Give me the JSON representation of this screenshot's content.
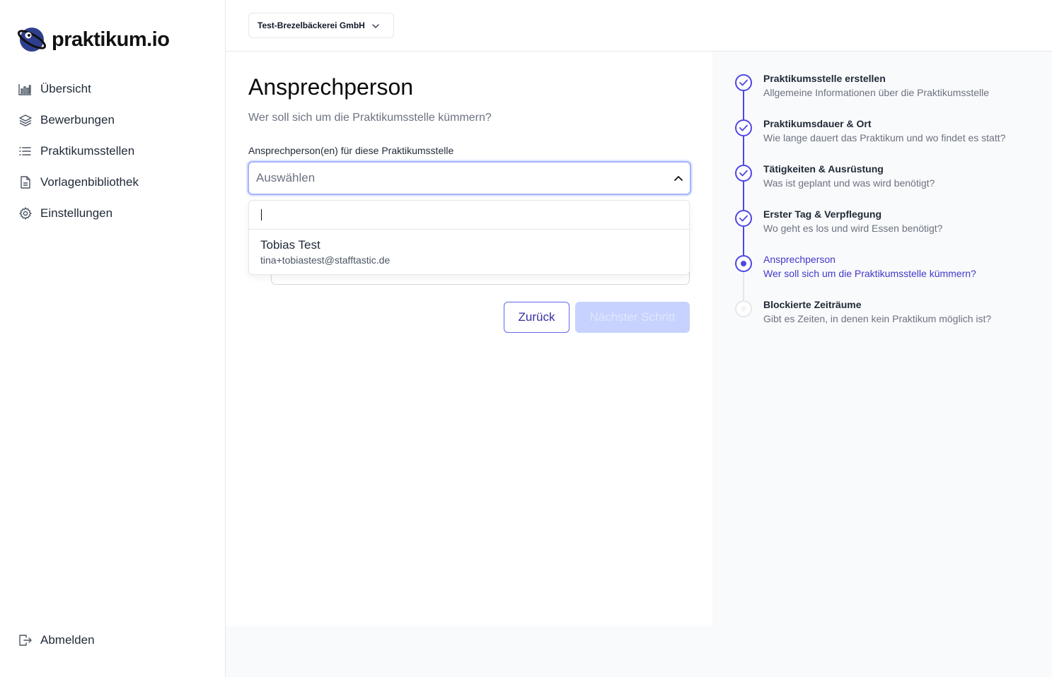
{
  "brand": {
    "name": "praktikum.io"
  },
  "sidebar": {
    "items": [
      {
        "label": "Übersicht",
        "icon": "bar-chart-icon"
      },
      {
        "label": "Bewerbungen",
        "icon": "layers-icon"
      },
      {
        "label": "Praktikumsstellen",
        "icon": "list-icon"
      },
      {
        "label": "Vorlagenbibliothek",
        "icon": "document-icon"
      },
      {
        "label": "Einstellungen",
        "icon": "gear-icon"
      }
    ],
    "logout_label": "Abmelden"
  },
  "topbar": {
    "company": "Test-Brezelbäckerei GmbH"
  },
  "main": {
    "title": "Ansprechperson",
    "subtitle": "Wer soll sich um die Praktikumsstelle kümmern?",
    "field_label": "Ansprechperson(en) für diese Praktikumsstelle",
    "select_placeholder": "Auswählen",
    "options": [
      {
        "name": "Tobias Test",
        "email": "tina+tobiastest@stafftastic.de"
      }
    ],
    "back_label": "Zurück",
    "next_label": "Nächster Schritt"
  },
  "steps": [
    {
      "title": "Praktikumsstelle erstellen",
      "desc": "Allgemeine Informationen über die Praktikumsstelle",
      "status": "complete"
    },
    {
      "title": "Praktikumsdauer & Ort",
      "desc": "Wie lange dauert das Praktikum und wo findet es statt?",
      "status": "complete"
    },
    {
      "title": "Tätigkeiten & Ausrüstung",
      "desc": "Was ist geplant und was wird benötigt?",
      "status": "complete"
    },
    {
      "title": "Erster Tag & Verpflegung",
      "desc": "Wo geht es los und wird Essen benötigt?",
      "status": "complete"
    },
    {
      "title": "Ansprechperson",
      "desc": "Wer soll sich um die Praktikumsstelle kümmern?",
      "status": "current"
    },
    {
      "title": "Blockierte Zeiträume",
      "desc": "Gibt es Zeiten, in denen kein Praktikum möglich ist?",
      "status": "upcoming"
    }
  ],
  "colors": {
    "accent": "#4f46e5",
    "accent_light": "#c7d2fe",
    "logo_blue": "#2f3f8f"
  }
}
